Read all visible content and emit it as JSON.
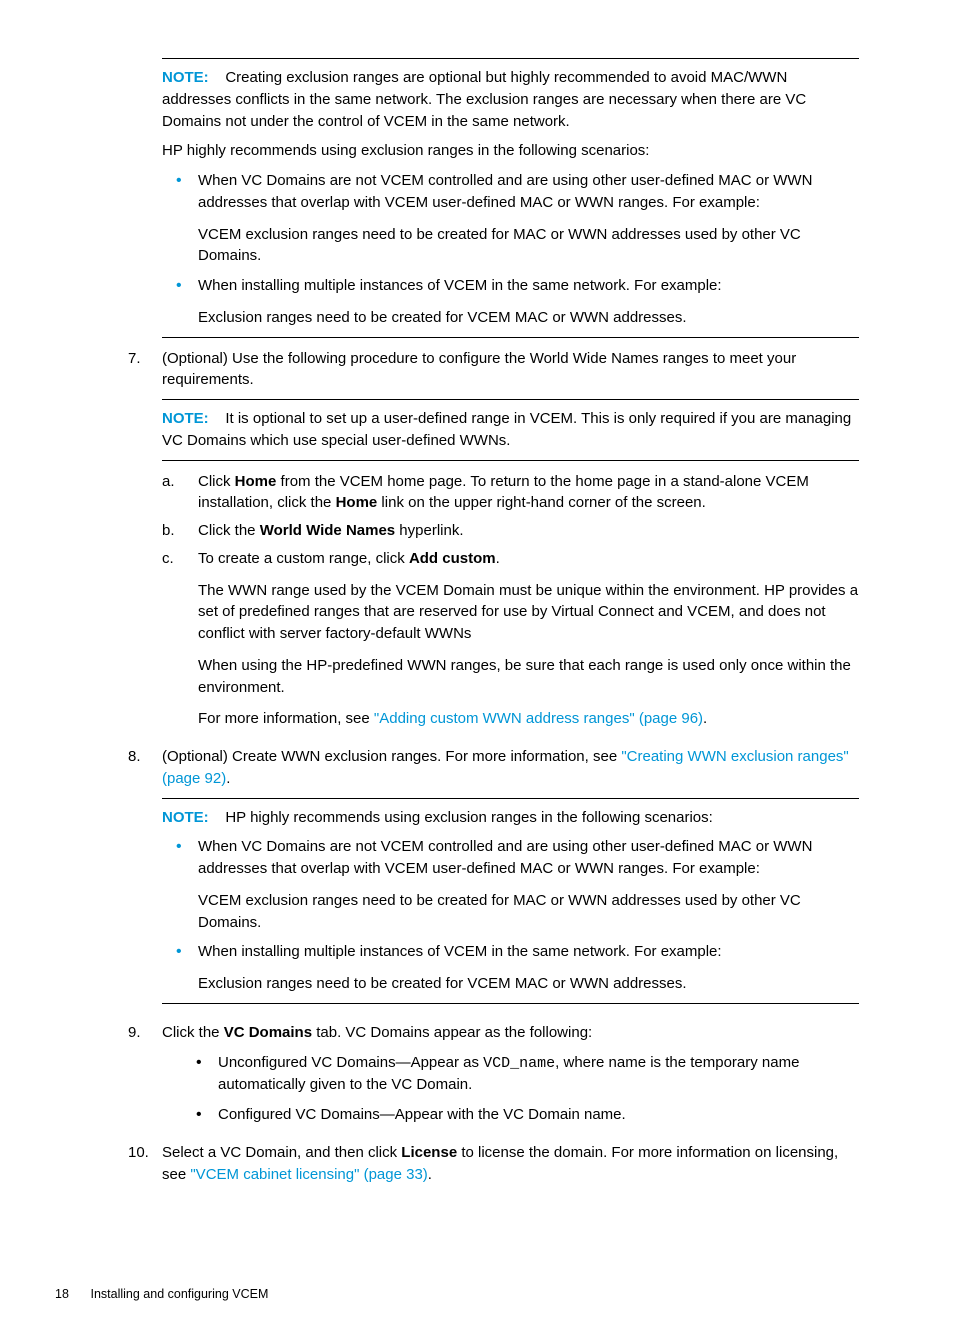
{
  "note_label": "NOTE:",
  "top_note_body": "Creating exclusion ranges are optional but highly recommended to avoid MAC/WWN addresses conflicts in the same network. The exclusion ranges are necessary when there are VC Domains not under the control of VCEM in the same network.",
  "top_recommend": "HP highly recommends using exclusion ranges in the following scenarios:",
  "top_bullets": {
    "b1_main": "When VC Domains are not VCEM controlled and are using other user-defined MAC or WWN addresses that overlap with VCEM user-defined MAC or WWN ranges. For example:",
    "b1_sub": "VCEM exclusion ranges need to be created for MAC or WWN addresses used by other VC Domains.",
    "b2_main": "When installing multiple instances of VCEM in the same network. For example:",
    "b2_sub": "Exclusion ranges need to be created for VCEM MAC or WWN addresses."
  },
  "step7": {
    "num": "7.",
    "intro": "(Optional) Use the following procedure to configure the World Wide Names ranges to meet your requirements.",
    "note_body": "It is optional to set up a user-defined range in VCEM. This is only required if you are managing VC Domains which use special user-defined WWNs.",
    "a": {
      "marker": "a.",
      "pre": "Click ",
      "home1": "Home",
      "mid1": " from the VCEM home page. To return to the home page in a stand-alone VCEM installation, click the ",
      "home2": "Home",
      "post1": " link on the upper right-hand corner of the screen."
    },
    "b": {
      "marker": "b.",
      "pre": "Click the ",
      "wwn": "World Wide Names",
      "post": " hyperlink."
    },
    "c": {
      "marker": "c.",
      "pre": "To create a custom range, click ",
      "add": "Add custom",
      "post": ".",
      "p1": "The WWN range used by the VCEM Domain must be unique within the environment. HP provides a set of predefined ranges that are reserved for use by Virtual Connect and VCEM, and does not conflict with server factory-default WWNs",
      "p2": "When using the HP-predefined WWN ranges, be sure that each range is used only once within the environment.",
      "p3_pre": "For more information, see ",
      "p3_link": "\"Adding custom WWN address ranges\" (page 96)",
      "p3_post": "."
    }
  },
  "step8": {
    "num": "8.",
    "intro_pre": "(Optional) Create WWN exclusion ranges. For more information, see ",
    "intro_link": "\"Creating WWN exclusion ranges\" (page 92)",
    "intro_post": ".",
    "note_body": "HP highly recommends using exclusion ranges in the following scenarios:",
    "b1_main": "When VC Domains are not VCEM controlled and are using other user-defined MAC or WWN addresses that overlap with VCEM user-defined MAC or WWN ranges. For example:",
    "b1_sub": "VCEM exclusion ranges need to be created for MAC or WWN addresses used by other VC Domains.",
    "b2_main": "When installing multiple instances of VCEM in the same network. For example:",
    "b2_sub": "Exclusion ranges need to be created for VCEM MAC or WWN addresses."
  },
  "step9": {
    "num": "9.",
    "pre": "Click the ",
    "vcd": "VC Domains",
    "post": " tab. VC Domains appear as the following:",
    "b1_pre": "Unconfigured VC Domains—Appear as ",
    "b1_mono": "VCD_name",
    "b1_post": ", where name is the temporary name automatically given to the VC Domain.",
    "b2": "Configured VC Domains—Appear with the VC Domain name."
  },
  "step10": {
    "num": "10.",
    "pre": "Select a VC Domain, and then click ",
    "license": "License",
    "mid": " to license the domain. For more information on licensing, see ",
    "link": "\"VCEM cabinet licensing\" (page 33)",
    "post": "."
  },
  "footer": {
    "page": "18",
    "title": "Installing and configuring VCEM"
  }
}
